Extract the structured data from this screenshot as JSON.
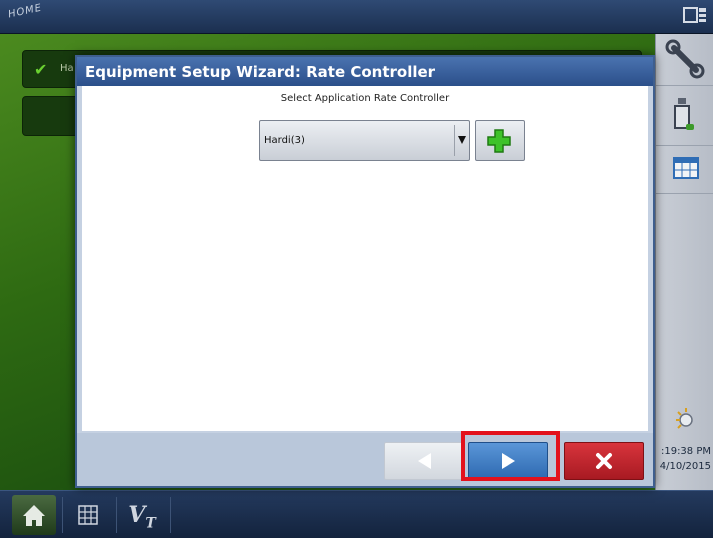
{
  "topbar": {
    "logo_text": "HOME"
  },
  "background": {
    "row1_text": "Ha"
  },
  "dialog": {
    "title": "Equipment Setup Wizard:  Rate Controller",
    "prompt": "Select Application Rate Controller",
    "rate_controller": {
      "selected": "Hardi(3)"
    }
  },
  "sidebar": {
    "time": ":19:38 PM",
    "date": "4/10/2015"
  },
  "colors": {
    "title_bar": "#2b4f8a",
    "next_button": "#2e69b0",
    "cancel_button": "#c22830",
    "highlight": "#e3121c",
    "field_green": "#2e6a12"
  },
  "icons": {
    "topbar": [
      "logo-icon",
      "screen-layout-icon"
    ],
    "sidebar": [
      "wrench-icon",
      "bottle-icon",
      "table-icon",
      "light-icon"
    ],
    "nav": [
      "home-icon",
      "grid-icon",
      "vt-icon"
    ],
    "dialog": [
      "add-icon",
      "back-arrow-icon",
      "next-arrow-icon",
      "close-icon",
      "check-icon"
    ]
  }
}
